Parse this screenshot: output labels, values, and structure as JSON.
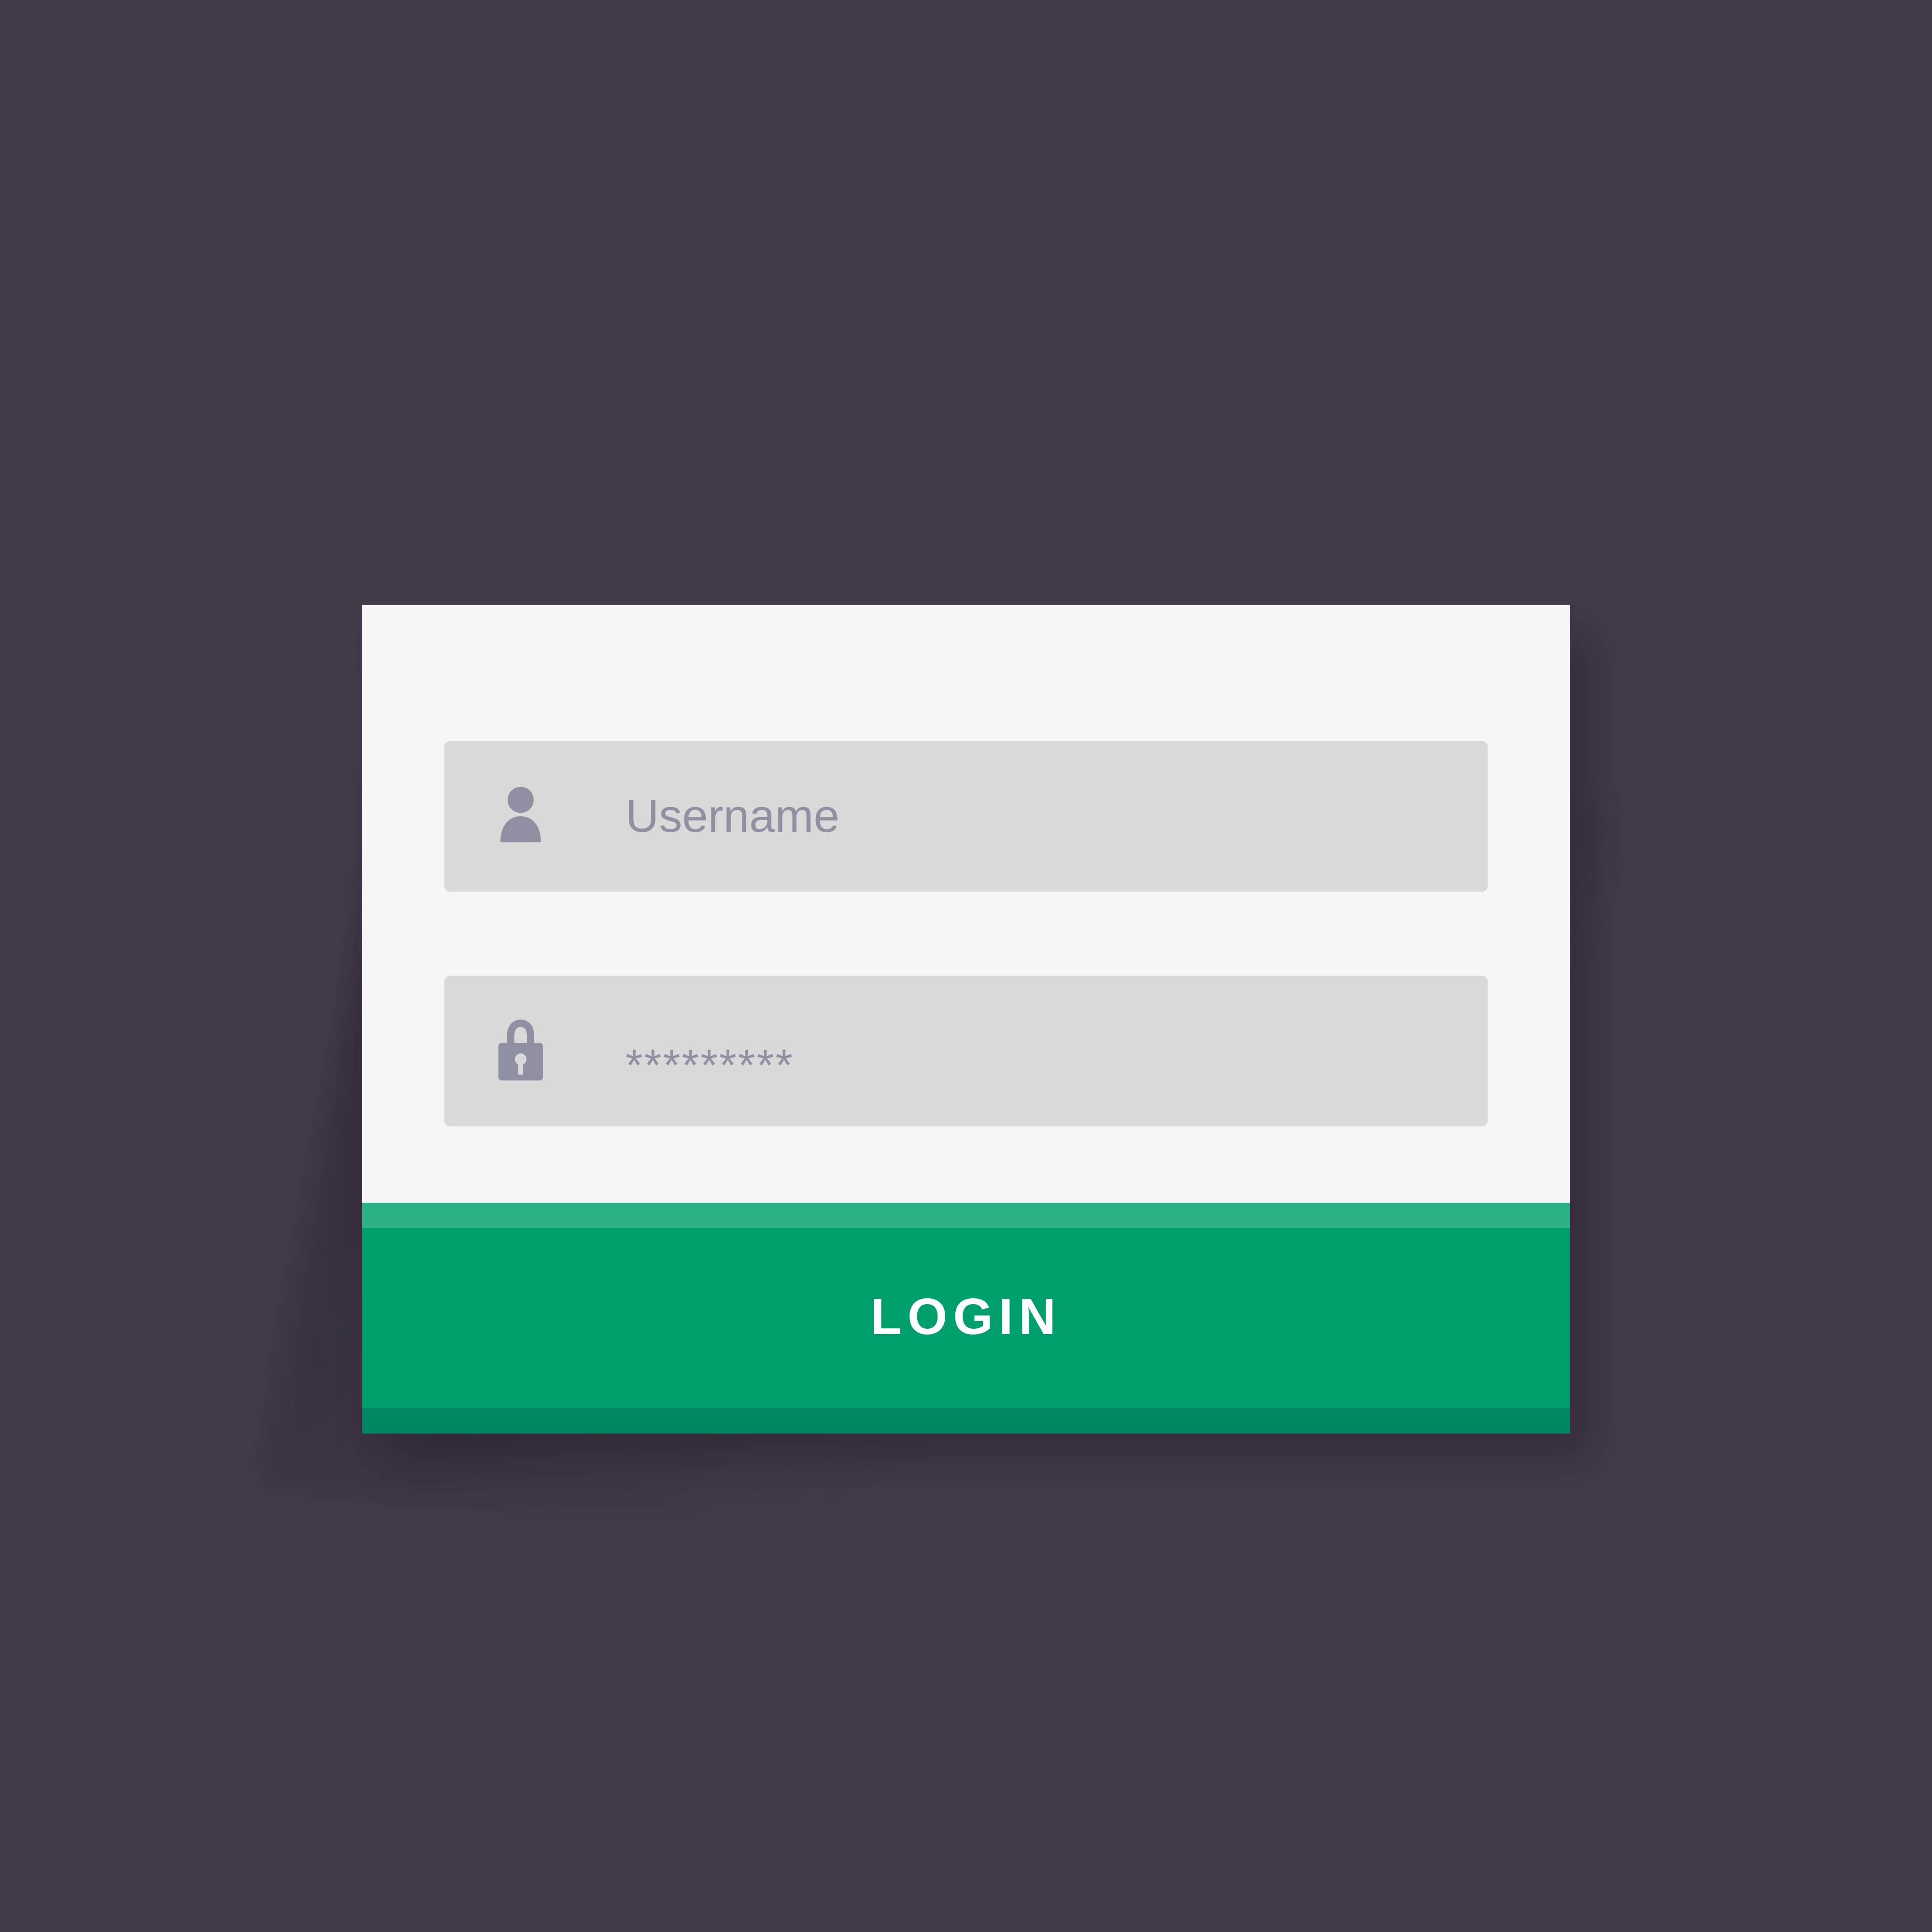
{
  "background_color": "#433b4a",
  "login_form": {
    "card_color": "#f6f6f6",
    "field_color": "#d9d9d9",
    "placeholder_color": "#8f90a1",
    "username": {
      "icon": "user-icon",
      "placeholder": "Username"
    },
    "password": {
      "icon": "lock-icon",
      "value": "*********"
    },
    "login_button": {
      "label": "LOGIN",
      "color": "#009e6d",
      "top_accent_color": "#2bb087",
      "bottom_accent_color": "#008660",
      "text_color": "#ffffff"
    }
  }
}
